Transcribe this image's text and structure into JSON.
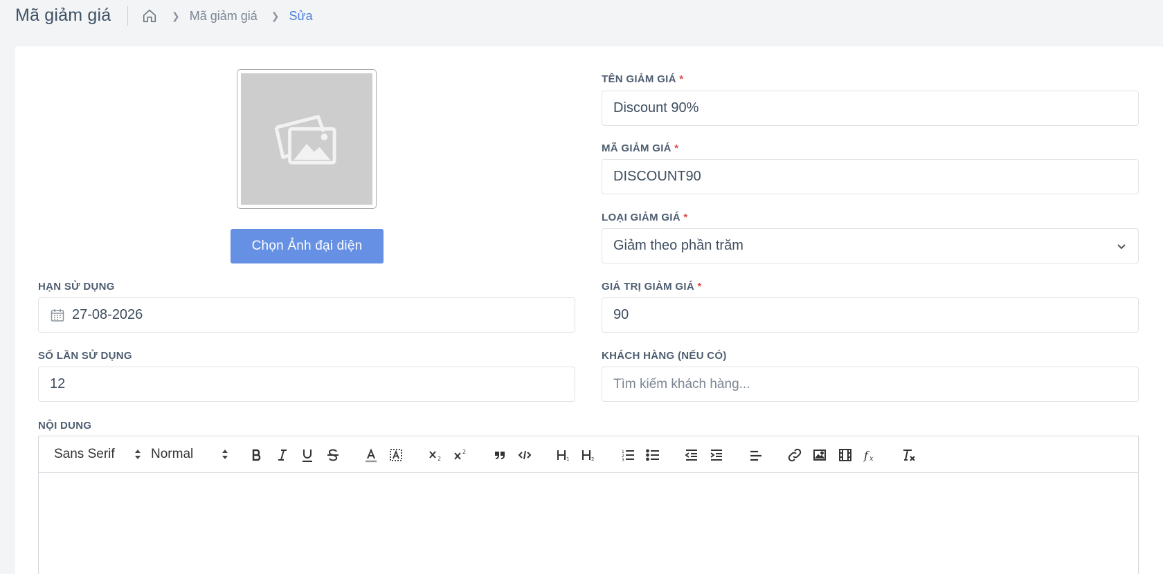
{
  "header": {
    "title": "Mã giảm giá",
    "breadcrumb": {
      "parent": "Mã giảm giá",
      "current": "Sửa"
    }
  },
  "avatar": {
    "button_label": "Chọn Ảnh đại diện"
  },
  "fields": {
    "name": {
      "label": "TÊN GIẢM GIÁ",
      "required": "*",
      "value": "Discount 90%"
    },
    "code": {
      "label": "MÃ GIẢM GIÁ",
      "required": "*",
      "value": "DISCOUNT90"
    },
    "type": {
      "label": "LOẠI GIẢM GIÁ",
      "required": "*",
      "value": "Giảm theo phần trăm"
    },
    "expiry": {
      "label": "HẠN SỬ DỤNG",
      "value": "27-08-2026"
    },
    "amount": {
      "label": "GIÁ TRỊ GIẢM GIÁ",
      "required": "*",
      "value": "90"
    },
    "usage": {
      "label": "SỐ LẦN SỬ DỤNG",
      "value": "12"
    },
    "customer": {
      "label": "KHÁCH HÀNG (NẾU CÓ)",
      "placeholder": "Tìm kiếm khách hàng..."
    },
    "content": {
      "label": "NỘI DUNG"
    }
  },
  "editor": {
    "font": "Sans Serif",
    "size": "Normal",
    "buttons": [
      "bold-icon",
      "italic-icon",
      "underline-icon",
      "strike-icon",
      "text-color-icon",
      "background-color-icon",
      "subscript-icon",
      "superscript-icon",
      "blockquote-icon",
      "code-block-icon",
      "header-1-icon",
      "header-2-icon",
      "ordered-list-icon",
      "bullet-list-icon",
      "indent-decrease-icon",
      "indent-increase-icon",
      "align-icon",
      "link-icon",
      "image-icon",
      "video-icon",
      "formula-icon",
      "clean-icon"
    ]
  },
  "colors": {
    "primary": "#6590e4",
    "active_link": "#4a7fdc",
    "required": "#e04b4b",
    "background": "#f2f4f5"
  }
}
